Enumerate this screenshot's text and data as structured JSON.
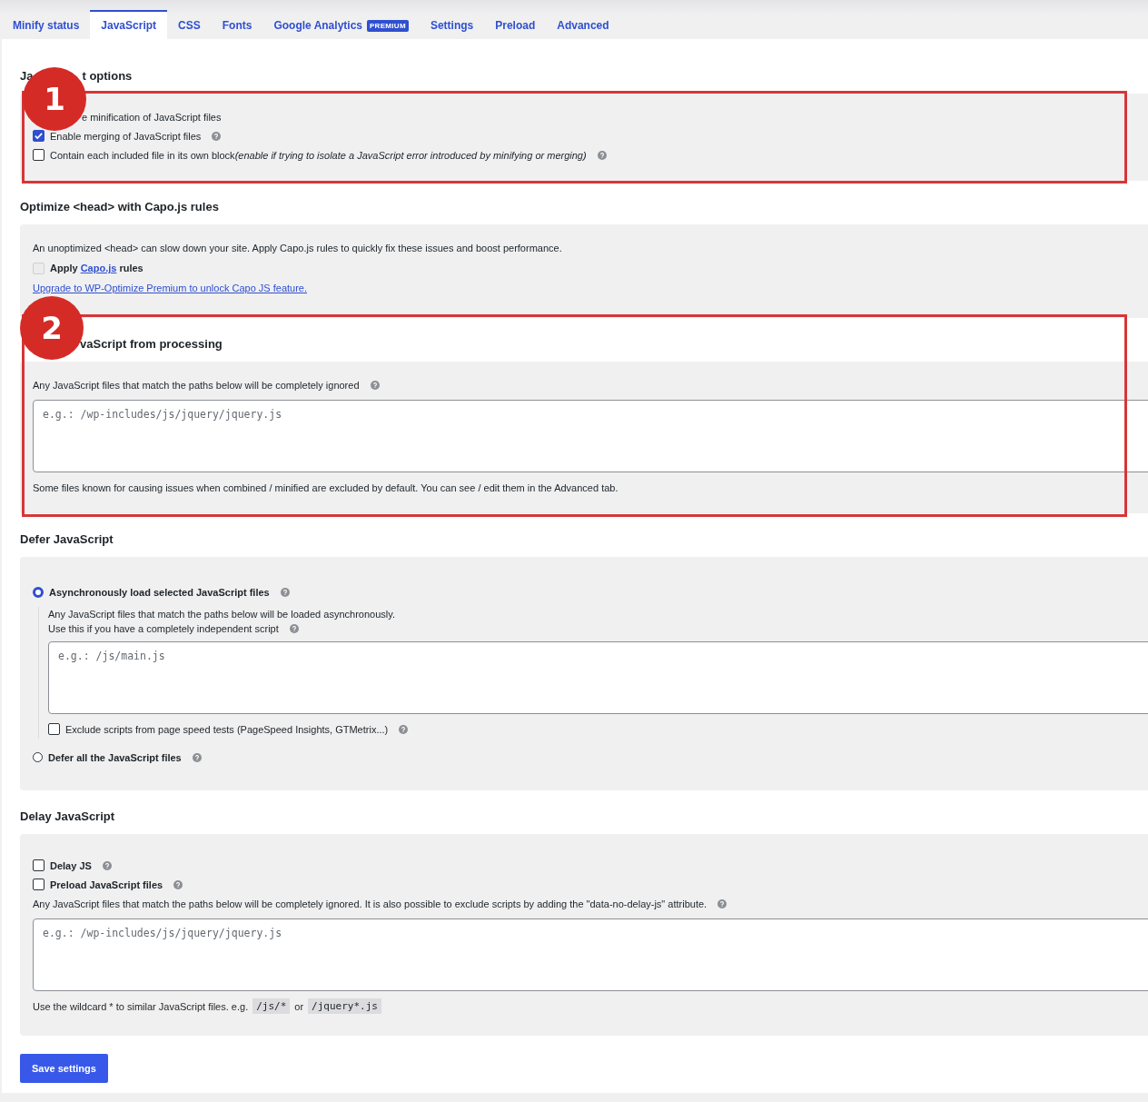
{
  "tabs": [
    {
      "label": "Minify status",
      "selected": false
    },
    {
      "label": "JavaScript",
      "selected": true
    },
    {
      "label": "CSS",
      "selected": false
    },
    {
      "label": "Fonts",
      "selected": false
    },
    {
      "label": "Google Analytics",
      "selected": false,
      "badge": "PREMIUM"
    },
    {
      "label": "Settings",
      "selected": false
    },
    {
      "label": "Preload",
      "selected": false
    },
    {
      "label": "Advanced",
      "selected": false
    }
  ],
  "sections": [
    {
      "heading_parts": [
        "Ja",
        "t options"
      ],
      "annotation": {
        "number": "1",
        "kind": "card"
      },
      "rows": [
        {
          "kind": "cut",
          "text": "e minification of JavaScript files"
        },
        {
          "kind": "checkbox",
          "label": "Enable merging of JavaScript files",
          "checked": true,
          "strong": false,
          "help": true
        },
        {
          "kind": "checkbox",
          "label": "Contain each included file in its own block",
          "note": "(enable if trying to isolate a JavaScript error introduced by minifying or merging)",
          "checked": false,
          "strong": false,
          "help": true
        }
      ]
    },
    {
      "heading_parts": [
        "Optimize <head> with Capo.js rules"
      ],
      "rows": [
        {
          "kind": "text",
          "text": "An unoptimized <head> can slow down your site. Apply Capo.js rules to quickly fix these issues and boost performance.",
          "help": false
        },
        {
          "kind": "capo",
          "before": "Apply",
          "link": "Capo.js",
          "after": "rules",
          "checked": false,
          "disabled": true
        },
        {
          "kind": "link",
          "text": "Upgrade to WP-Optimize Premium to unlock Capo JS feature."
        }
      ]
    },
    {
      "heading_parts": [
        "vaScript from processing"
      ],
      "annotation": {
        "number": "2",
        "kind": "section"
      },
      "rows": [
        {
          "kind": "text",
          "text": "Any JavaScript files that match the paths below will be completely ignored",
          "help": true
        },
        {
          "kind": "textarea",
          "placeholder": "e.g.: /wp-includes/js/jquery/jquery.js"
        },
        {
          "kind": "text",
          "text": "Some files known for causing issues when combined / minified are excluded by default. You can see / edit them in the Advanced tab.",
          "help": false
        }
      ]
    },
    {
      "heading_parts": [
        "Defer JavaScript"
      ],
      "rows": [
        {
          "kind": "radio",
          "label": "Asynchronously load selected JavaScript files",
          "selected": true,
          "help": true,
          "children": [
            {
              "kind": "text",
              "text": "Any JavaScript files that match the paths below will be loaded asynchronously.",
              "help": false
            },
            {
              "kind": "text",
              "text": "Use this if you have a completely independent script",
              "help": true
            },
            {
              "kind": "textarea",
              "placeholder": "e.g.: /js/main.js"
            },
            {
              "kind": "checkbox",
              "label": "Exclude scripts from page speed tests (PageSpeed Insights, GTMetrix...)",
              "checked": false,
              "strong": false,
              "help": true
            }
          ]
        },
        {
          "kind": "radio",
          "label": "Defer all the JavaScript files",
          "selected": false,
          "help": true
        }
      ]
    },
    {
      "heading_parts": [
        "Delay JavaScript"
      ],
      "rows": [
        {
          "kind": "checkbox",
          "label": "Delay JS",
          "checked": false,
          "strong": true,
          "help": true
        },
        {
          "kind": "checkbox",
          "label": "Preload JavaScript files",
          "checked": false,
          "strong": true,
          "help": true
        },
        {
          "kind": "text",
          "text": "Any JavaScript files that match the paths below will be completely ignored. It is also possible to exclude scripts by adding the \"data-no-delay-js\" attribute.",
          "help": true
        },
        {
          "kind": "textarea",
          "placeholder": "e.g.: /wp-includes/js/jquery/jquery.js"
        },
        {
          "kind": "parts",
          "parts": [
            {
              "kind": "text",
              "text": "Use the wildcard * to similar JavaScript files. e.g."
            },
            {
              "kind": "code",
              "text": "/js/*"
            },
            {
              "kind": "text",
              "text": "or"
            },
            {
              "kind": "code",
              "text": "/jquery*.js"
            }
          ]
        }
      ]
    }
  ],
  "save_button": "Save settings"
}
